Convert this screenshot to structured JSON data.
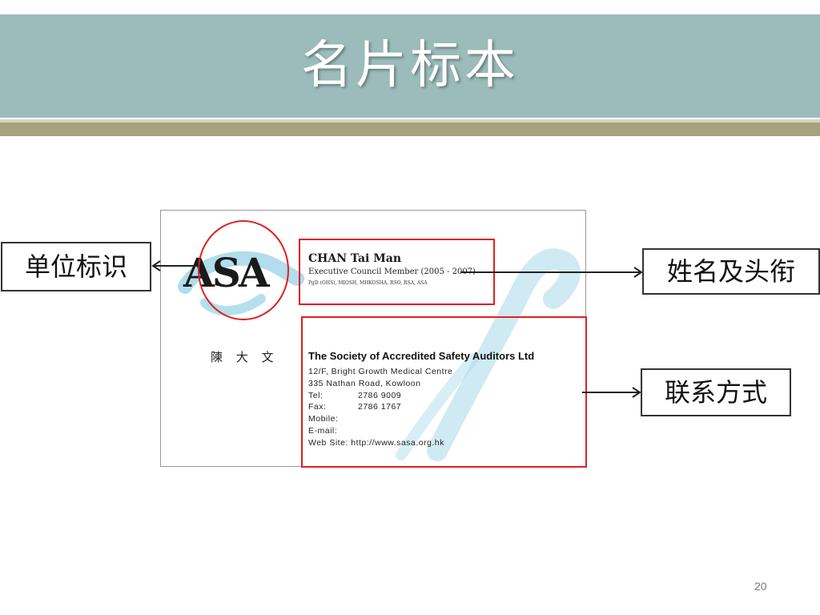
{
  "slide": {
    "title": "名片标本",
    "page_number": "20"
  },
  "labels": {
    "org_logo": "单位标识",
    "name_title": "姓名及头衔",
    "contact": "联系方式"
  },
  "card": {
    "logo_text": "ASA",
    "chinese_name": "陳 大 文",
    "person_name": "CHAN Tai Man",
    "person_title": "Executive Council Member (2005 - 2007)",
    "person_quals": "PgD (OHS), MIOSH, MHKOSHA, RSO, RSA, ASA",
    "org_name": "The Society of Accredited Safety Auditors Ltd",
    "address_line1": "12/F, Bright Growth Medical Centre",
    "address_line2": "335 Nathan Road, Kowloon",
    "tel_label": "Tel:",
    "tel_value": "2786 9009",
    "fax_label": "Fax:",
    "fax_value": "2786 1767",
    "mobile_label": "Mobile:",
    "email_label": "E-mail:",
    "website_line": "Web Site: http://www.sasa.org.hk"
  },
  "colors": {
    "title_bar": "#9bbcbb",
    "title_stripe": "#a8a27c",
    "highlight": "#e02020",
    "swoosh": "#a9d9ea"
  }
}
